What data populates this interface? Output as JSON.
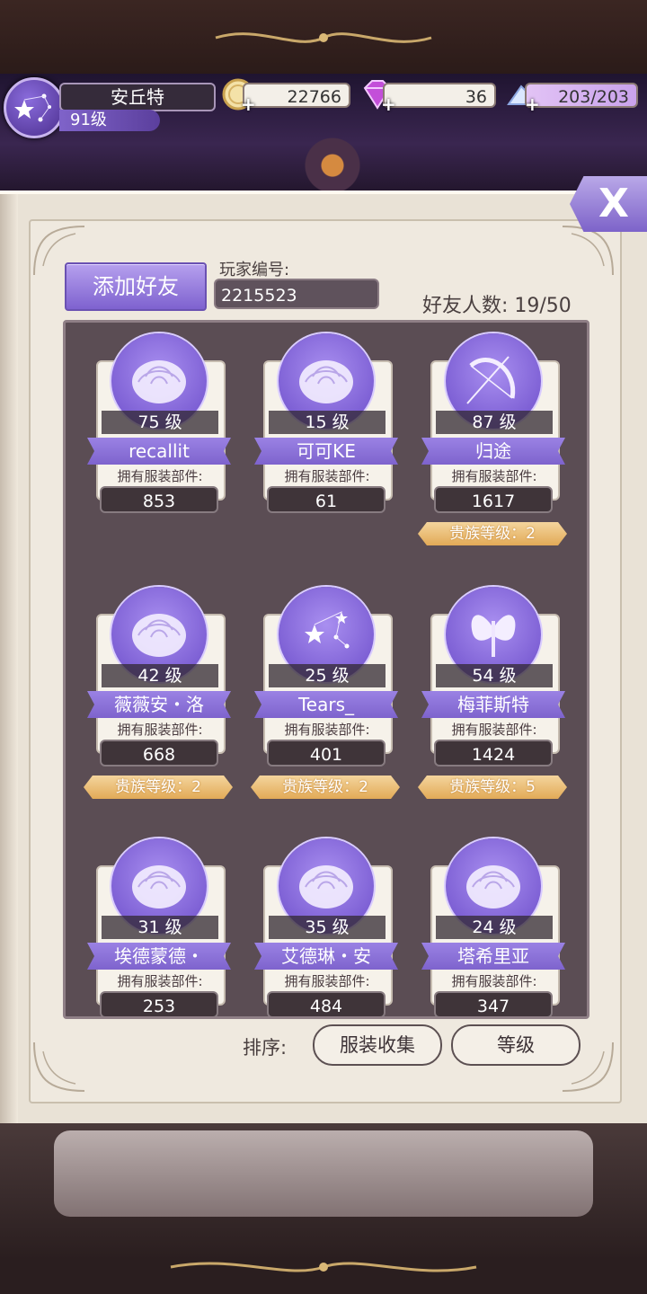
{
  "player": {
    "name": "安丘特",
    "level": "91级"
  },
  "resources": {
    "gold": {
      "value": "22766",
      "icon": "gold-coin-icon"
    },
    "diamond": {
      "value": "36",
      "icon": "diamond-icon"
    },
    "stamina": {
      "value": "203/203",
      "icon": "crystal-shoe-icon"
    }
  },
  "close": {
    "label": "X"
  },
  "friends_page": {
    "add_friend_label": "添加好友",
    "player_id_label": "玩家编号:",
    "player_id_value": "2215523",
    "friend_count": "好友人数:  19/50",
    "owned_label": "拥有服装部件:",
    "friends": [
      {
        "level": "75  级",
        "name": "recallit",
        "items": "853",
        "noble": "",
        "avatar": "rose-icon"
      },
      {
        "level": "15  级",
        "name": "可可KE",
        "items": "61",
        "noble": "",
        "avatar": "rose-icon"
      },
      {
        "level": "87  级",
        "name": "归途",
        "items": "1617",
        "noble": "贵族等级：2",
        "avatar": "bow-icon"
      },
      {
        "level": "42  级",
        "name": "薇薇安・洛",
        "items": "668",
        "noble": "贵族等级：2",
        "avatar": "rose-icon"
      },
      {
        "level": "25  级",
        "name": "Tears_",
        "items": "401",
        "noble": "贵族等级：2",
        "avatar": "constellation-icon"
      },
      {
        "level": "54  级",
        "name": "梅菲斯特",
        "items": "1424",
        "noble": "贵族等级：5",
        "avatar": "butterfly-icon"
      },
      {
        "level": "31  级",
        "name": "埃德蒙德・",
        "items": "253",
        "noble": "",
        "avatar": "rose-icon"
      },
      {
        "level": "35  级",
        "name": "艾德琳・安",
        "items": "484",
        "noble": "",
        "avatar": "rose-icon"
      },
      {
        "level": "24  级",
        "name": "塔希里亚",
        "items": "347",
        "noble": "",
        "avatar": "rose-icon"
      }
    ],
    "sort_label": "排序:",
    "sort_options": [
      "服装收集",
      "等级"
    ]
  },
  "colors": {
    "accent": "#8a6fd8",
    "panel": "#5b4d54",
    "gold": "#e2aa57"
  }
}
